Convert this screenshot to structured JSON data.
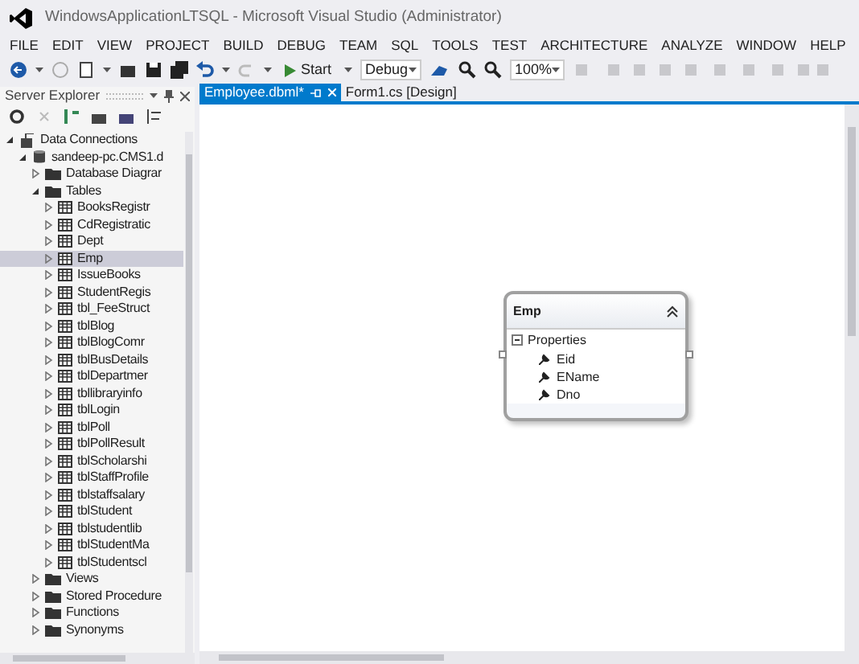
{
  "window": {
    "title": "WindowsApplicationLTSQL - Microsoft Visual Studio (Administrator)"
  },
  "menu": [
    "FILE",
    "EDIT",
    "VIEW",
    "PROJECT",
    "BUILD",
    "DEBUG",
    "TEAM",
    "SQL",
    "TOOLS",
    "TEST",
    "ARCHITECTURE",
    "ANALYZE",
    "WINDOW",
    "HELP"
  ],
  "toolbar": {
    "start": "Start",
    "configuration": "Debug",
    "zoom": "100%"
  },
  "server_explorer": {
    "title": "Server Explorer",
    "tree": [
      {
        "label": "Data Connections",
        "kind": "connection",
        "expanded": true,
        "selected": false,
        "children": [
          {
            "label": "sandeep-pc.CMS1.d",
            "kind": "database",
            "expanded": true,
            "selected": false,
            "children": [
              {
                "label": "Database Diagrar",
                "kind": "folder",
                "expanded": false,
                "selected": false
              },
              {
                "label": "Tables",
                "kind": "folder",
                "expanded": true,
                "selected": false,
                "children": [
                  {
                    "label": "BooksRegistr",
                    "kind": "table",
                    "expanded": false,
                    "selected": false
                  },
                  {
                    "label": "CdRegistratic",
                    "kind": "table",
                    "expanded": false,
                    "selected": false
                  },
                  {
                    "label": "Dept",
                    "kind": "table",
                    "expanded": false,
                    "selected": false
                  },
                  {
                    "label": "Emp",
                    "kind": "table",
                    "expanded": false,
                    "selected": true
                  },
                  {
                    "label": "IssueBooks",
                    "kind": "table",
                    "expanded": false,
                    "selected": false
                  },
                  {
                    "label": "StudentRegis",
                    "kind": "table",
                    "expanded": false,
                    "selected": false
                  },
                  {
                    "label": "tbl_FeeStruct",
                    "kind": "table",
                    "expanded": false,
                    "selected": false
                  },
                  {
                    "label": "tblBlog",
                    "kind": "table",
                    "expanded": false,
                    "selected": false
                  },
                  {
                    "label": "tblBlogComr",
                    "kind": "table",
                    "expanded": false,
                    "selected": false
                  },
                  {
                    "label": "tblBusDetails",
                    "kind": "table",
                    "expanded": false,
                    "selected": false
                  },
                  {
                    "label": "tblDepartmer",
                    "kind": "table",
                    "expanded": false,
                    "selected": false
                  },
                  {
                    "label": "tbllibraryinfo",
                    "kind": "table",
                    "expanded": false,
                    "selected": false
                  },
                  {
                    "label": "tblLogin",
                    "kind": "table",
                    "expanded": false,
                    "selected": false
                  },
                  {
                    "label": "tblPoll",
                    "kind": "table",
                    "expanded": false,
                    "selected": false
                  },
                  {
                    "label": "tblPollResult",
                    "kind": "table",
                    "expanded": false,
                    "selected": false
                  },
                  {
                    "label": "tblScholarshi",
                    "kind": "table",
                    "expanded": false,
                    "selected": false
                  },
                  {
                    "label": "tblStaffProfile",
                    "kind": "table",
                    "expanded": false,
                    "selected": false
                  },
                  {
                    "label": "tblstaffsalary",
                    "kind": "table",
                    "expanded": false,
                    "selected": false
                  },
                  {
                    "label": "tblStudent",
                    "kind": "table",
                    "expanded": false,
                    "selected": false
                  },
                  {
                    "label": "tblstudentlib",
                    "kind": "table",
                    "expanded": false,
                    "selected": false
                  },
                  {
                    "label": "tblStudentMa",
                    "kind": "table",
                    "expanded": false,
                    "selected": false
                  },
                  {
                    "label": "tblStudentscl",
                    "kind": "table",
                    "expanded": false,
                    "selected": false
                  }
                ]
              },
              {
                "label": "Views",
                "kind": "folder",
                "expanded": false,
                "selected": false
              },
              {
                "label": "Stored Procedure",
                "kind": "folder",
                "expanded": false,
                "selected": false
              },
              {
                "label": "Functions",
                "kind": "folder",
                "expanded": false,
                "selected": false
              },
              {
                "label": "Synonyms",
                "kind": "folder",
                "expanded": false,
                "selected": false
              }
            ]
          }
        ]
      }
    ]
  },
  "tabs": [
    {
      "label": "Employee.dbml*",
      "selected": true
    },
    {
      "label": "Form1.cs [Design]",
      "selected": false
    }
  ],
  "entity": {
    "name": "Emp",
    "section": "Properties",
    "expanded": true,
    "properties": [
      "Eid",
      "EName",
      "Dno"
    ]
  }
}
